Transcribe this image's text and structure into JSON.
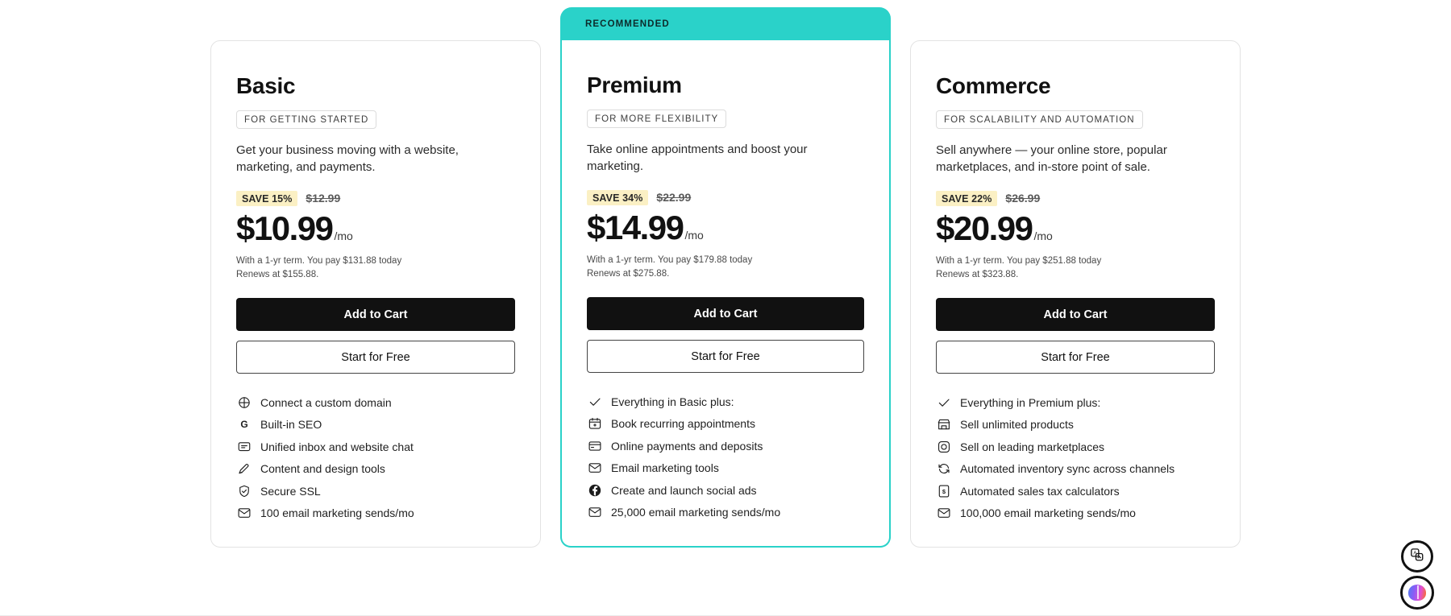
{
  "plans": [
    {
      "name": "Basic",
      "featured": false,
      "ribbon": "",
      "tagline": "FOR GETTING STARTED",
      "description": "Get your business moving with a website, marketing, and payments.",
      "save_badge": "SAVE 15%",
      "old_price": "$12.99",
      "price": "$10.99",
      "per": "/mo",
      "terms_line1": "With a 1-yr term. You pay $131.88 today",
      "terms_line2": "Renews at $155.88.",
      "primary_button": "Add to Cart",
      "secondary_button": "Start for Free",
      "features": [
        {
          "icon": "globe-icon",
          "label": "Connect a custom domain"
        },
        {
          "icon": "google-seo-icon",
          "label": "Built-in SEO"
        },
        {
          "icon": "chat-bubble-icon",
          "label": "Unified inbox and website chat"
        },
        {
          "icon": "design-pen-icon",
          "label": "Content and design tools"
        },
        {
          "icon": "shield-check-icon",
          "label": "Secure SSL"
        },
        {
          "icon": "envelope-icon",
          "label": "100 email marketing sends/mo"
        }
      ]
    },
    {
      "name": "Premium",
      "featured": true,
      "ribbon": "RECOMMENDED",
      "tagline": "FOR MORE FLEXIBILITY",
      "description": "Take online appointments and boost your marketing.",
      "save_badge": "SAVE 34%",
      "old_price": "$22.99",
      "price": "$14.99",
      "per": "/mo",
      "terms_line1": "With a 1-yr term. You pay $179.88 today",
      "terms_line2": "Renews at $275.88.",
      "primary_button": "Add to Cart",
      "secondary_button": "Start for Free",
      "features": [
        {
          "icon": "check-icon",
          "label": "Everything in Basic plus:"
        },
        {
          "icon": "calendar-icon",
          "label": "Book recurring appointments"
        },
        {
          "icon": "credit-card-icon",
          "label": "Online payments and deposits"
        },
        {
          "icon": "envelope-icon",
          "label": "Email marketing tools"
        },
        {
          "icon": "facebook-icon",
          "label": "Create and launch social ads"
        },
        {
          "icon": "envelope-icon",
          "label": "25,000 email marketing sends/mo"
        }
      ]
    },
    {
      "name": "Commerce",
      "featured": false,
      "ribbon": "",
      "tagline": "FOR SCALABILITY AND AUTOMATION",
      "description": "Sell anywhere — your online store, popular marketplaces, and in-store point of sale.",
      "save_badge": "SAVE 22%",
      "old_price": "$26.99",
      "price": "$20.99",
      "per": "/mo",
      "terms_line1": "With a 1-yr term. You pay $251.88 today",
      "terms_line2": "Renews at $323.88.",
      "primary_button": "Add to Cart",
      "secondary_button": "Start for Free",
      "features": [
        {
          "icon": "check-icon",
          "label": "Everything in Premium plus:"
        },
        {
          "icon": "storefront-icon",
          "label": "Sell unlimited products"
        },
        {
          "icon": "marketplace-icon",
          "label": "Sell on leading marketplaces"
        },
        {
          "icon": "sync-icon",
          "label": "Automated inventory sync across channels"
        },
        {
          "icon": "tax-dollar-icon",
          "label": "Automated sales tax calculators"
        },
        {
          "icon": "envelope-icon",
          "label": "100,000 email marketing sends/mo"
        }
      ]
    }
  ],
  "floating_widgets": [
    {
      "name": "translate-button",
      "icon": "translate-icon"
    },
    {
      "name": "ai-assistant-button",
      "icon": "brain-icon"
    }
  ],
  "colors": {
    "accent_teal": "#2AD2C9",
    "save_badge_bg": "#FBF0C4",
    "primary_button_bg": "#111111",
    "card_border": "#E3E3E3"
  }
}
